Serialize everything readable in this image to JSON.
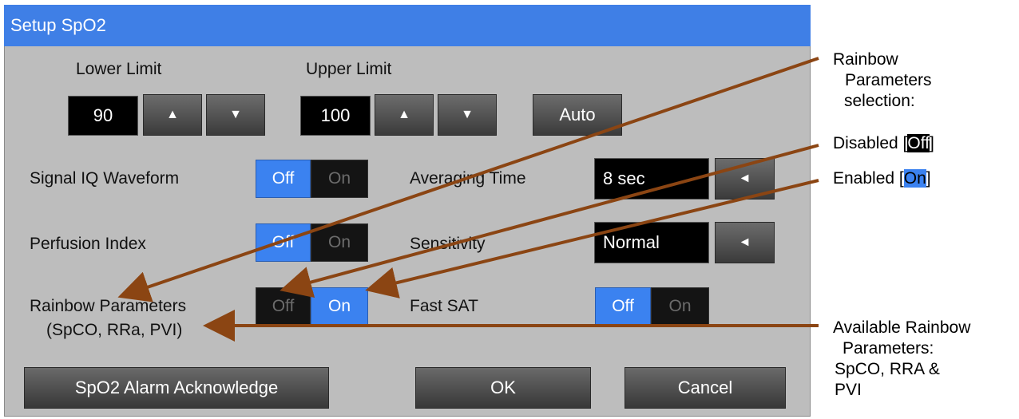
{
  "dialog": {
    "title": "Setup SpO2"
  },
  "limits": {
    "lower_label": "Lower Limit",
    "lower_value": "90",
    "upper_label": "Upper Limit",
    "upper_value": "100",
    "up_glyph": "▲",
    "down_glyph": "▼",
    "auto_label": "Auto"
  },
  "settings": {
    "signal_iq": {
      "label": "Signal IQ Waveform",
      "off": "Off",
      "on": "On",
      "selected": "Off"
    },
    "perfusion": {
      "label": "Perfusion Index",
      "off": "Off",
      "on": "On",
      "selected": "Off"
    },
    "rainbow": {
      "label": "Rainbow Parameters",
      "sublabel": "(SpCO, RRa, PVI)",
      "off": "Off",
      "on": "On",
      "selected": "On"
    },
    "averaging": {
      "label": "Averaging Time",
      "value": "8 sec",
      "left_glyph": "◄"
    },
    "sensitivity": {
      "label": "Sensitivity",
      "value": "Normal",
      "left_glyph": "◄"
    },
    "fast_sat": {
      "label": "Fast SAT",
      "off": "Off",
      "on": "On",
      "selected": "Off"
    }
  },
  "buttons": {
    "alarm_ack": "SpO2 Alarm Acknowledge",
    "ok": "OK",
    "cancel": "Cancel"
  },
  "annotations": {
    "rainbow_line1": "Rainbow",
    "rainbow_line2": "Parameters",
    "rainbow_line3": "selection:",
    "disabled_prefix": "Disabled [",
    "disabled_value": "Off",
    "disabled_suffix": "]",
    "enabled_prefix": "Enabled [",
    "enabled_value": "On",
    "enabled_suffix": "]",
    "available_line1": "Available Rainbow",
    "available_line2": "Parameters:",
    "available_line3": "SpCO, RRA &",
    "available_line4": "PVI"
  },
  "colors": {
    "title_bar": "#3f7fe6",
    "panel_bg": "#bdbdbd",
    "toggle_on": "#3b82f0",
    "annotation_arrow": "#8b4513"
  }
}
